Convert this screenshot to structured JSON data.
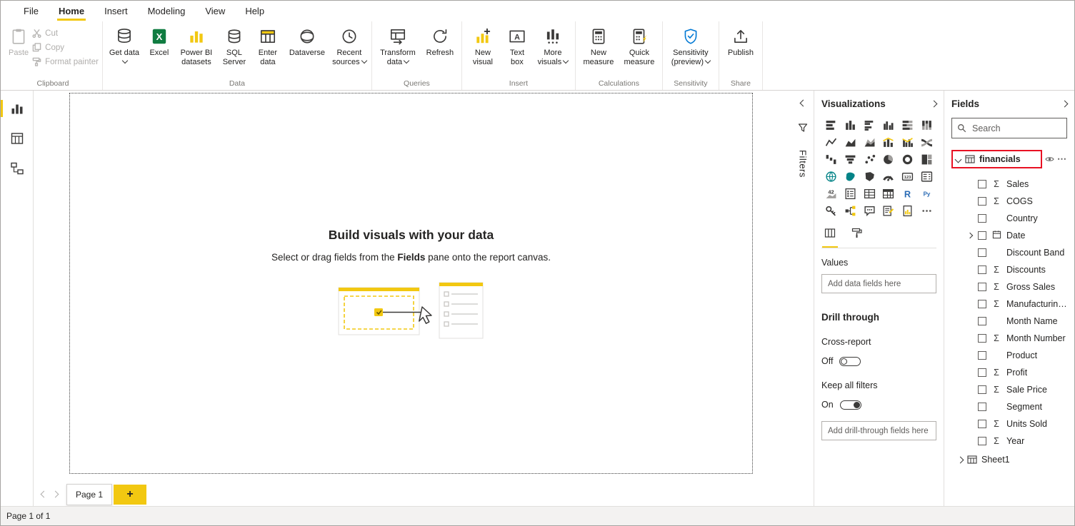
{
  "colors": {
    "accent_yellow": "#F2C811",
    "highlight_red": "#E81123",
    "excel_green": "#107C41",
    "sensitivity_blue": "#0078D4",
    "text_dark": "#252423",
    "text_gray": "#605E5C"
  },
  "menubar": {
    "items": [
      {
        "label": "File",
        "active": false
      },
      {
        "label": "Home",
        "active": true
      },
      {
        "label": "Insert",
        "active": false
      },
      {
        "label": "Modeling",
        "active": false
      },
      {
        "label": "View",
        "active": false
      },
      {
        "label": "Help",
        "active": false
      }
    ]
  },
  "ribbon": {
    "clipboard": {
      "group_label": "Clipboard",
      "paste": "Paste",
      "cut": "Cut",
      "copy": "Copy",
      "format_painter": "Format painter"
    },
    "data": {
      "group_label": "Data",
      "get_data": "Get data",
      "excel": "Excel",
      "power_bi_datasets": "Power BI datasets",
      "sql_server": "SQL Server",
      "enter_data": "Enter data",
      "dataverse": "Dataverse",
      "recent_sources": "Recent sources"
    },
    "queries": {
      "group_label": "Queries",
      "transform_data": "Transform data",
      "refresh": "Refresh"
    },
    "insert": {
      "group_label": "Insert",
      "new_visual": "New visual",
      "text_box": "Text box",
      "more_visuals": "More visuals"
    },
    "calculations": {
      "group_label": "Calculations",
      "new_measure": "New measure",
      "quick_measure": "Quick measure"
    },
    "sensitivity": {
      "group_label": "Sensitivity",
      "sensitivity_button": "Sensitivity (preview)"
    },
    "share": {
      "group_label": "Share",
      "publish": "Publish"
    }
  },
  "left_nav": {
    "items": [
      "report-view",
      "data-view",
      "model-view"
    ],
    "active": "report-view"
  },
  "canvas": {
    "title": "Build visuals with your data",
    "subtitle_pre": "Select or drag fields from the ",
    "subtitle_bold": "Fields",
    "subtitle_post": " pane onto the report canvas."
  },
  "filters_strip": {
    "label": "Filters"
  },
  "visualizations_pane": {
    "title": "Visualizations",
    "icons": [
      "stacked-bar-chart",
      "stacked-column-chart",
      "clustered-bar-chart",
      "clustered-column-chart",
      "100-stacked-bar-chart",
      "100-stacked-column-chart",
      "line-chart",
      "area-chart",
      "stacked-area-chart",
      "line-and-stacked-column-chart",
      "line-and-clustered-column-chart",
      "ribbon-chart",
      "waterfall-chart",
      "funnel-chart",
      "scatter-chart",
      "pie-chart",
      "donut-chart",
      "treemap",
      "map",
      "filled-map",
      "shape-map",
      "gauge",
      "card",
      "multi-row-card",
      "kpi",
      "slicer",
      "table",
      "matrix",
      "r-script-visual",
      "python-visual",
      "key-influencers",
      "decomposition-tree",
      "qa-visual",
      "smart-narrative",
      "paginated-report",
      "more-options"
    ],
    "tab_icons": [
      "fields-tab",
      "format-tab"
    ],
    "values_label": "Values",
    "add_data_fields_placeholder": "Add data fields here",
    "drill_through_title": "Drill through",
    "cross_report_label": "Cross-report",
    "cross_report_state": "Off",
    "keep_all_filters_label": "Keep all filters",
    "keep_all_filters_state": "On",
    "add_drill_fields_placeholder": "Add drill-through fields here"
  },
  "fields_pane": {
    "title": "Fields",
    "search_placeholder": "Search",
    "table": {
      "name": "financials"
    },
    "fields": [
      {
        "name": "Sales",
        "aggregate": true
      },
      {
        "name": "COGS",
        "aggregate": true
      },
      {
        "name": "Country",
        "aggregate": false
      },
      {
        "name": "Date",
        "aggregate": false,
        "date": true,
        "expandable": true
      },
      {
        "name": "Discount Band",
        "aggregate": false
      },
      {
        "name": "Discounts",
        "aggregate": true
      },
      {
        "name": "Gross Sales",
        "aggregate": true
      },
      {
        "name": "Manufacturing Pr...",
        "aggregate": true
      },
      {
        "name": "Month Name",
        "aggregate": false
      },
      {
        "name": "Month Number",
        "aggregate": true
      },
      {
        "name": "Product",
        "aggregate": false
      },
      {
        "name": "Profit",
        "aggregate": true
      },
      {
        "name": "Sale Price",
        "aggregate": true
      },
      {
        "name": "Segment",
        "aggregate": false
      },
      {
        "name": "Units Sold",
        "aggregate": true
      },
      {
        "name": "Year",
        "aggregate": true
      }
    ],
    "collapsed_table": "Sheet1"
  },
  "page_tabs": {
    "active_tab": "Page 1"
  },
  "statusbar": {
    "text": "Page 1 of 1"
  }
}
